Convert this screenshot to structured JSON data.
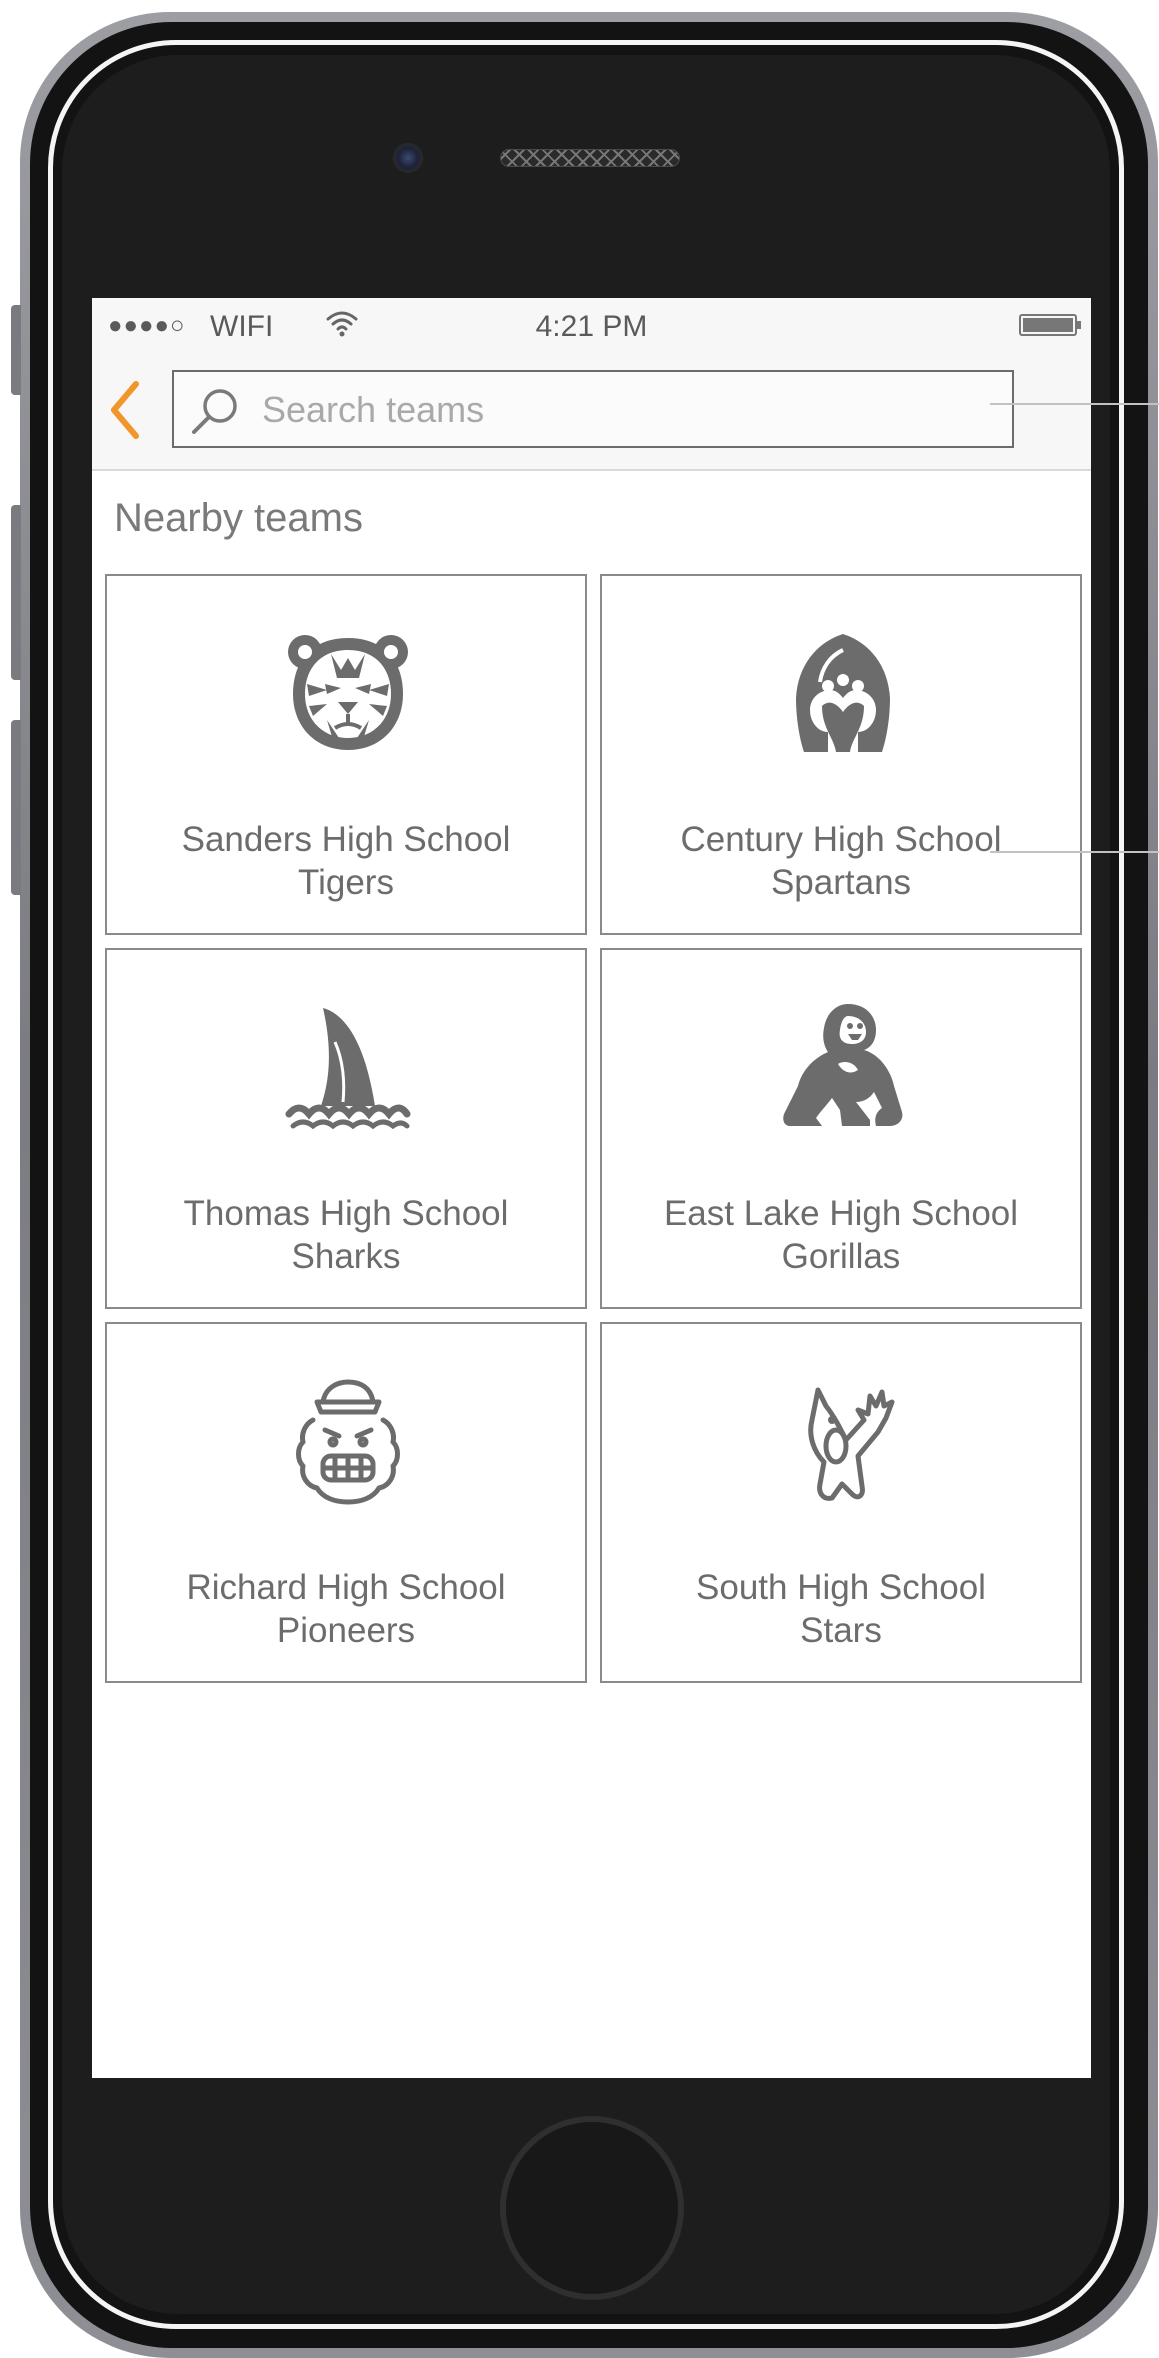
{
  "status_bar": {
    "signal": "●●●●○",
    "carrier": "WIFI",
    "time": "4:21 PM"
  },
  "header": {
    "back_icon": "chevron-left-icon",
    "search": {
      "icon": "search-icon",
      "placeholder": "Search teams",
      "value": ""
    }
  },
  "section_title": "Nearby teams",
  "teams": [
    {
      "line1": "Sanders High School",
      "line2": "Tigers",
      "icon": "tiger-icon"
    },
    {
      "line1": "Century High School",
      "line2": "Spartans",
      "icon": "spartan-helmet-icon"
    },
    {
      "line1": "Thomas High School",
      "line2": "Sharks",
      "icon": "shark-fin-icon"
    },
    {
      "line1": "East Lake High School",
      "line2": "Gorillas",
      "icon": "gorilla-icon"
    },
    {
      "line1": "Richard High School",
      "line2": "Pioneers",
      "icon": "pioneer-icon"
    },
    {
      "line1": "South High School",
      "line2": "Stars",
      "icon": "star-mascot-icon"
    }
  ],
  "colors": {
    "accent": "#f0962a",
    "icon_gray": "#6c6c6c",
    "card_border": "#8a8a8a"
  }
}
